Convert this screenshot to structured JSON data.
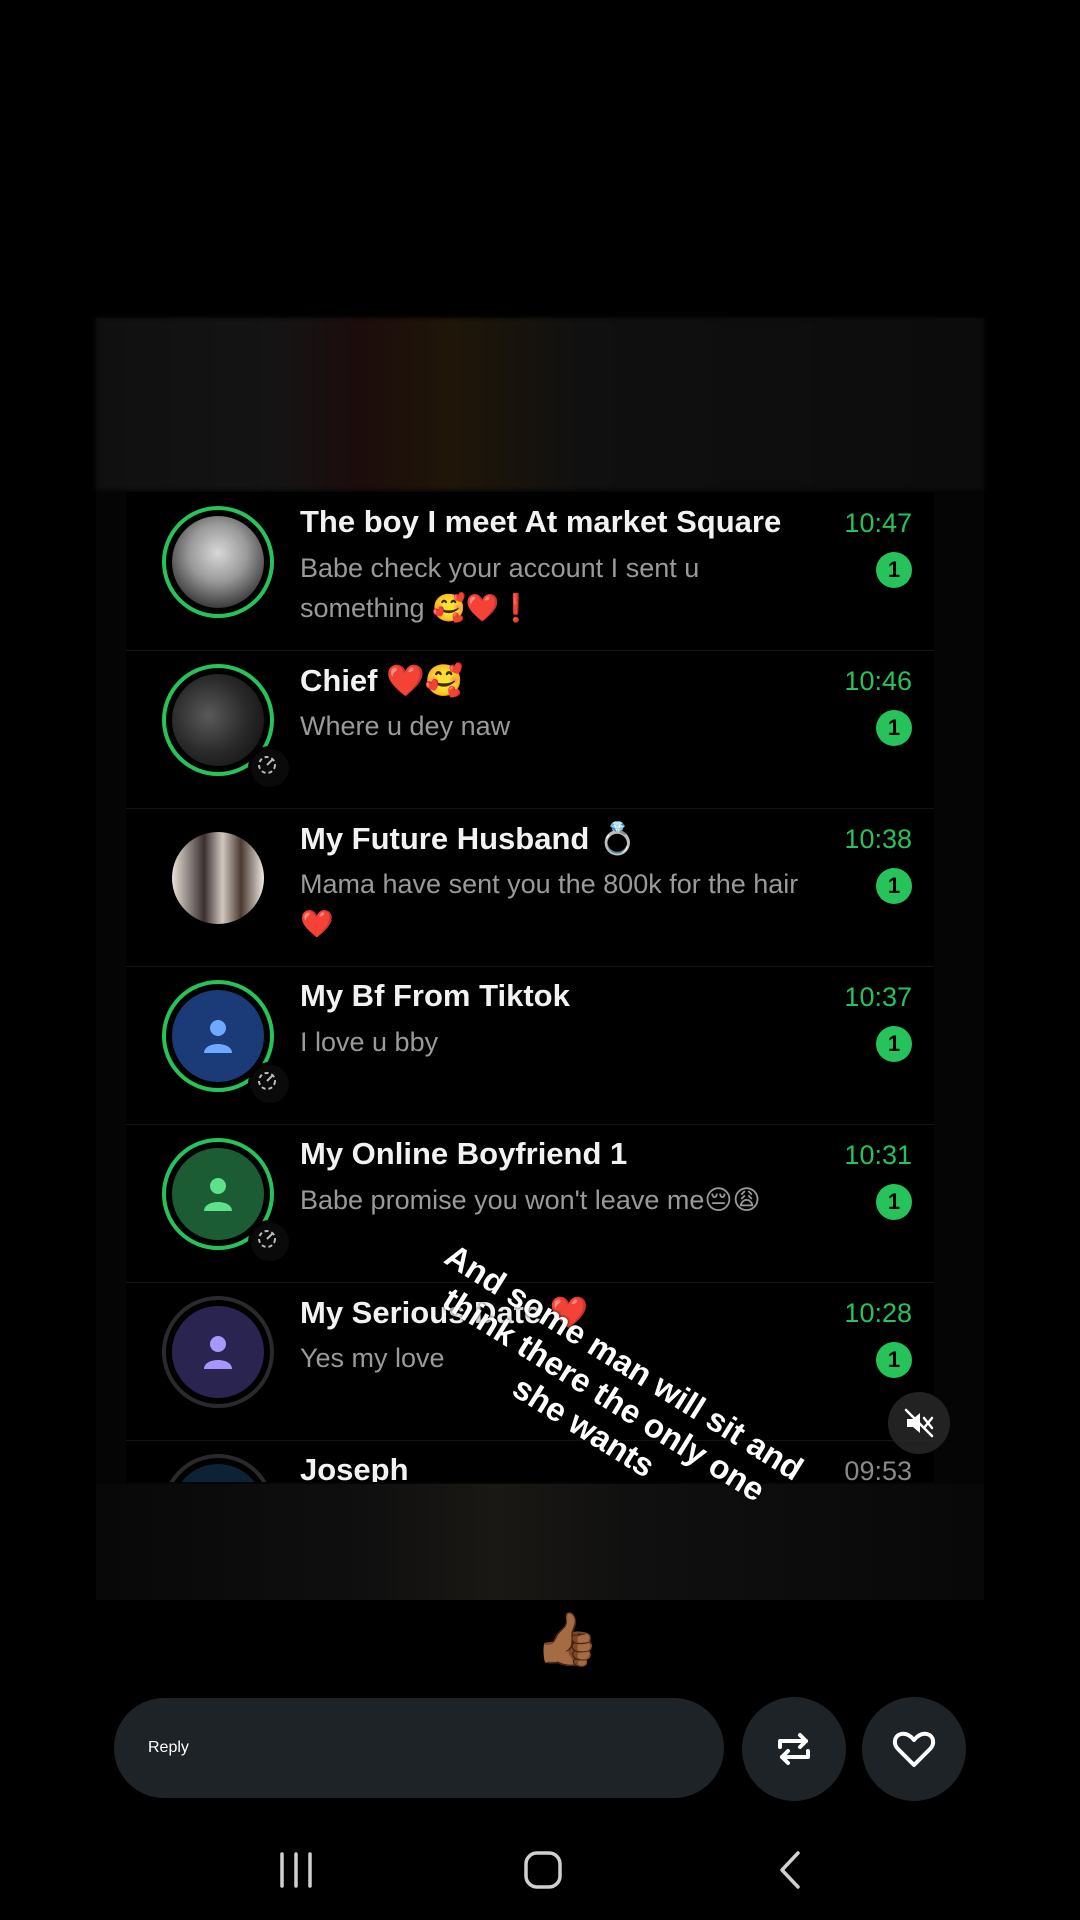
{
  "story": {
    "chats": [
      {
        "name": "The boy I meet At  market Square",
        "message": "Babe check your account I sent u something 🥰❤️❗",
        "time": "10:47",
        "unread": "1"
      },
      {
        "name": "Chief  ❤️🥰",
        "message": "Where u dey naw",
        "time": "10:46",
        "unread": "1"
      },
      {
        "name": "My Future Husband 💍",
        "message": "Mama have sent you the 800k for the hair ❤️",
        "time": "10:38",
        "unread": "1"
      },
      {
        "name": "My Bf From Tiktok",
        "message": "I love u bby",
        "time": "10:37",
        "unread": "1"
      },
      {
        "name": "My Online Boyfriend 1",
        "message": "Babe promise you won't leave me😔😩",
        "time": "10:31",
        "unread": "1"
      },
      {
        "name": "My Serious Date ❤️",
        "message": "Yes my love",
        "time": "10:28",
        "unread": "1"
      },
      {
        "name": "Joseph",
        "message": "",
        "time": "09:53",
        "unread": ""
      }
    ],
    "caption": "And some man will sit and think there the only one she wants"
  },
  "reactions": "😅👍🏾",
  "reply": {
    "placeholder": "Reply"
  },
  "icons": {
    "mute": "muted-speaker-icon",
    "repost": "repost-icon",
    "like": "heart-icon",
    "nav_recents": "recents-icon",
    "nav_home": "home-icon",
    "nav_back": "back-icon"
  },
  "colors": {
    "accent_green": "#25c35a",
    "field_bg": "#1e2327"
  }
}
